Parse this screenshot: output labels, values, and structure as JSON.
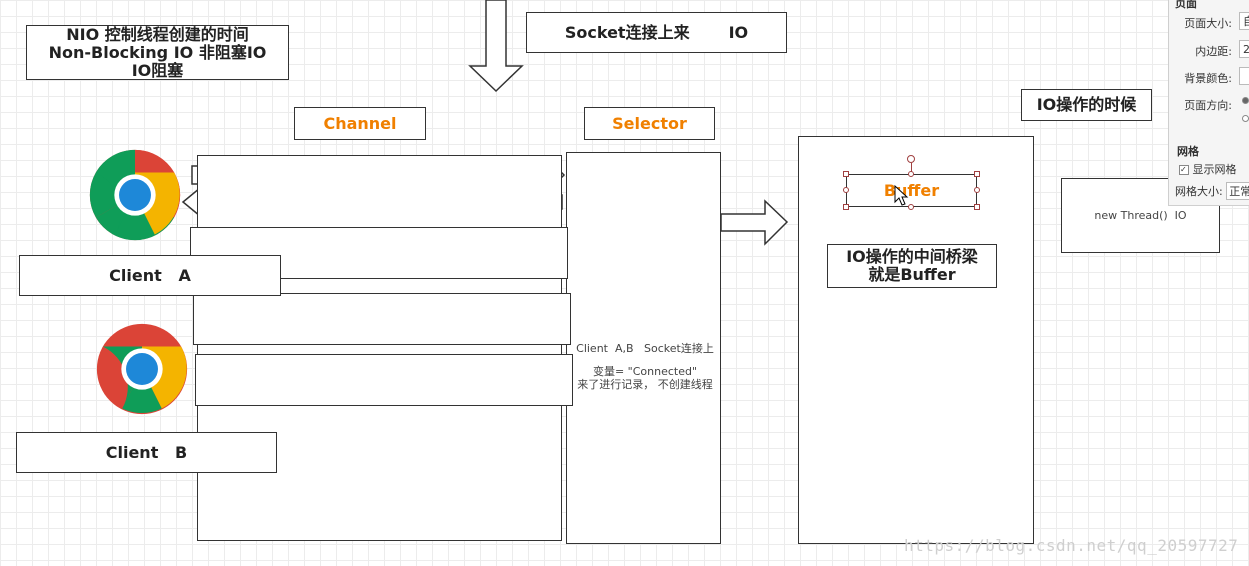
{
  "title_box": {
    "line1": "NIO   控制线程创建的时间",
    "line2": "Non-Blocking IO  非阻塞IO",
    "line3": "IO阻塞"
  },
  "socket_box": "Socket连接上来       IO",
  "channel_label": "Channel",
  "selector_label": "Selector",
  "io_time_label": "IO操作的时候",
  "buffer_label": "Buffer",
  "bridge_box": {
    "line1": "IO操作的中间桥梁",
    "line2": "就是Buffer"
  },
  "thread_box": "new Thread()  IO",
  "client_a": "Client   A",
  "client_b": "Client   B",
  "selector_note": {
    "line1": "Client  A,B   Socket连接上",
    "line2": "来了进行记录， 不创建线程",
    "line3": "变量= \"Connected\""
  },
  "panel": {
    "header": "页面",
    "page_size_label": "页面大小:",
    "page_size_value": "自",
    "padding_label": "内边距:",
    "padding_value": "2",
    "bg_color_label": "背景颜色:",
    "orientation_label": "页面方向:",
    "grid_header": "网格",
    "show_grid_label": "显示网格",
    "grid_size_label": "网格大小:",
    "grid_size_value": "正常"
  },
  "watermark": "https://blog.csdn.net/qq_20597727",
  "colors": {
    "accent": "#f08000",
    "stroke": "#333333"
  }
}
